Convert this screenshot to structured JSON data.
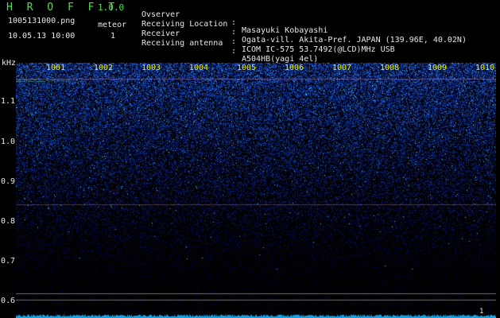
{
  "app": {
    "brand": "H R O F F T",
    "version": "1.0.0"
  },
  "file": {
    "name": "1005131000.png",
    "timestamp": "10.05.13 10:00"
  },
  "meteor": {
    "label": "meteor",
    "count": "1"
  },
  "info": [
    {
      "label": "Ovserver",
      "value": "Masayuki Kobayashi"
    },
    {
      "label": "Receiving Location",
      "value": "Ogata-vill. Akita-Pref. JAPAN (139.96E, 40.02N)"
    },
    {
      "label": "Receiver",
      "value": "ICOM IC-575 53.7492(@LCD)MHz USB"
    },
    {
      "label": "Receiving antenna",
      "value": "A504HB(yagi 4el)"
    }
  ],
  "axis": {
    "y_unit": "kHz",
    "y_ticks": [
      "1.1",
      "1.0",
      "0.9",
      "0.8",
      "0.7",
      "0.6"
    ],
    "x_ticks": [
      "1001",
      "1002",
      "1003",
      "1004",
      "1005",
      "1006",
      "1007",
      "1008",
      "1009",
      "1010"
    ]
  },
  "meteor_mark": "1",
  "colors": {
    "background": "#000000",
    "brand": "#4be24b",
    "text": "#e8e8e8",
    "tick_label": "#f0f000",
    "noise_high": "#2f4dff",
    "noise_low": "#08103a",
    "signal_line": "#ff55aa",
    "bottom_trace": "#20c0ff"
  }
}
